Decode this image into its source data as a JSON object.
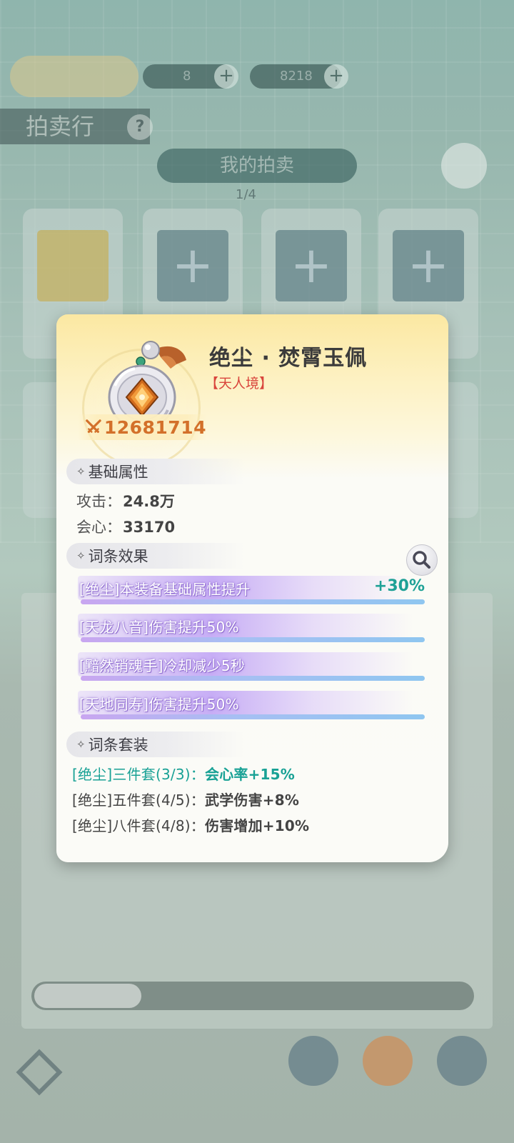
{
  "item": {
    "name": "绝尘 · 焚霄玉佩",
    "rank": "【天人境】",
    "power": "12681714"
  },
  "sections": {
    "base": "基础属性",
    "effects": "词条效果",
    "sets": "词条套装"
  },
  "base_stats": [
    {
      "key": "攻击：",
      "value": "24.8万"
    },
    {
      "key": "会心：",
      "value": "33170"
    }
  ],
  "effects": [
    {
      "text": "[绝尘]本装备基础属性提升",
      "bonus": "+30%"
    },
    {
      "text": "[天龙八音]伤害提升50%",
      "bonus": ""
    },
    {
      "text": "[黯然销魂手]冷却减少5秒",
      "bonus": ""
    },
    {
      "text": "[天地同寿]伤害提升50%",
      "bonus": ""
    }
  ],
  "set_bonuses": [
    {
      "label": "[绝尘]三件套(3/3)：",
      "bonus": "会心率+15%",
      "active": true
    },
    {
      "label": "[绝尘]五件套(4/5)：",
      "bonus": "武学伤害+8%",
      "active": false
    },
    {
      "label": "[绝尘]八件套(4/8)：",
      "bonus": "伤害增加+10%",
      "active": false
    }
  ],
  "background": {
    "title": "拍卖行",
    "tab": "我的拍卖",
    "page": "1/4",
    "res_1": "8",
    "res_2": "8218"
  },
  "colors": {
    "power": "#d3702a",
    "rank": "#d9453c",
    "active_set": "#18a195",
    "bonus": "#1fa196"
  },
  "icons": {
    "item": "jade-pendant-icon",
    "power": "crossed-swords-icon",
    "search": "magnifier-icon",
    "section": "four-point-star-icon"
  }
}
